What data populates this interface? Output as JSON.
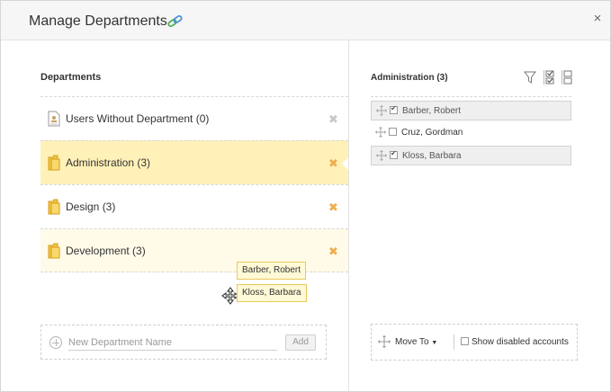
{
  "dialog": {
    "title": "Manage Departments",
    "close_glyph": "×"
  },
  "departments": {
    "section_title": "Departments",
    "items": [
      {
        "label": "Users Without Department (0)",
        "icon": "user-card-icon",
        "removable_style": "grey"
      },
      {
        "label": "Administration (3)",
        "icon": "folder-icon",
        "state": "selected"
      },
      {
        "label": "Design (3)",
        "icon": "folder-icon"
      },
      {
        "label": "Development (3)",
        "icon": "folder-icon",
        "state": "hover"
      }
    ],
    "remove_glyph": "✖"
  },
  "drag": {
    "items": [
      "Barber, Robert",
      "Kloss, Barbara"
    ]
  },
  "new_department": {
    "placeholder": "New Department Name",
    "value": "",
    "add_label": "Add"
  },
  "members_panel": {
    "title": "Administration (3)",
    "members": [
      {
        "name": "Barber, Robert",
        "checked": true
      },
      {
        "name": "Cruz, Gordman",
        "checked": false
      },
      {
        "name": "Kloss, Barbara",
        "checked": true
      }
    ],
    "move_to_label": "Move To",
    "show_disabled_label": "Show disabled accounts"
  },
  "colors": {
    "selected_row": "#fff1b8",
    "hover_row": "#fffbe8",
    "remove_active": "#f0ad4e",
    "remove_inactive": "#c7c7c7",
    "folder": "#f4c542"
  }
}
